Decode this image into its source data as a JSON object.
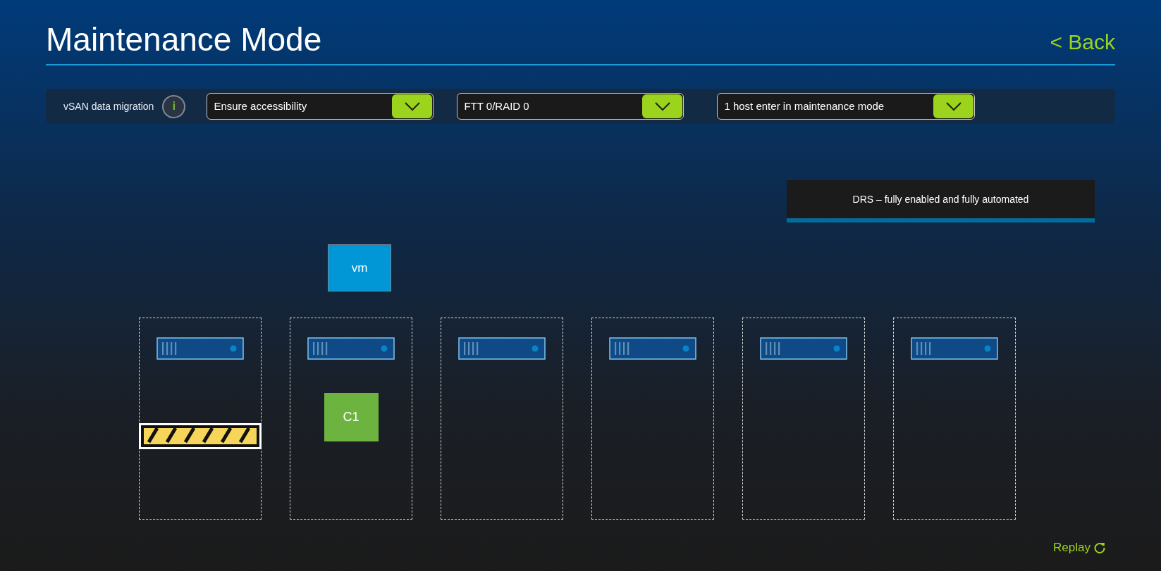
{
  "header": {
    "title": "Maintenance Mode",
    "back": "< Back"
  },
  "toolbar": {
    "label": "vSAN data migration",
    "info": "i",
    "dropdowns": [
      {
        "value": "Ensure accessibility"
      },
      {
        "value": "FTT 0/RAID 0"
      },
      {
        "value": "1 host enter in maintenance mode"
      }
    ]
  },
  "banner": {
    "text": "DRS – fully enabled and fully automated"
  },
  "vm": {
    "label": "vm"
  },
  "hosts": [
    {
      "kind": "hazard"
    },
    {
      "kind": "block",
      "label": "C1"
    },
    {
      "kind": "empty"
    },
    {
      "kind": "empty"
    },
    {
      "kind": "empty"
    },
    {
      "kind": "empty"
    }
  ],
  "replay": "Replay"
}
